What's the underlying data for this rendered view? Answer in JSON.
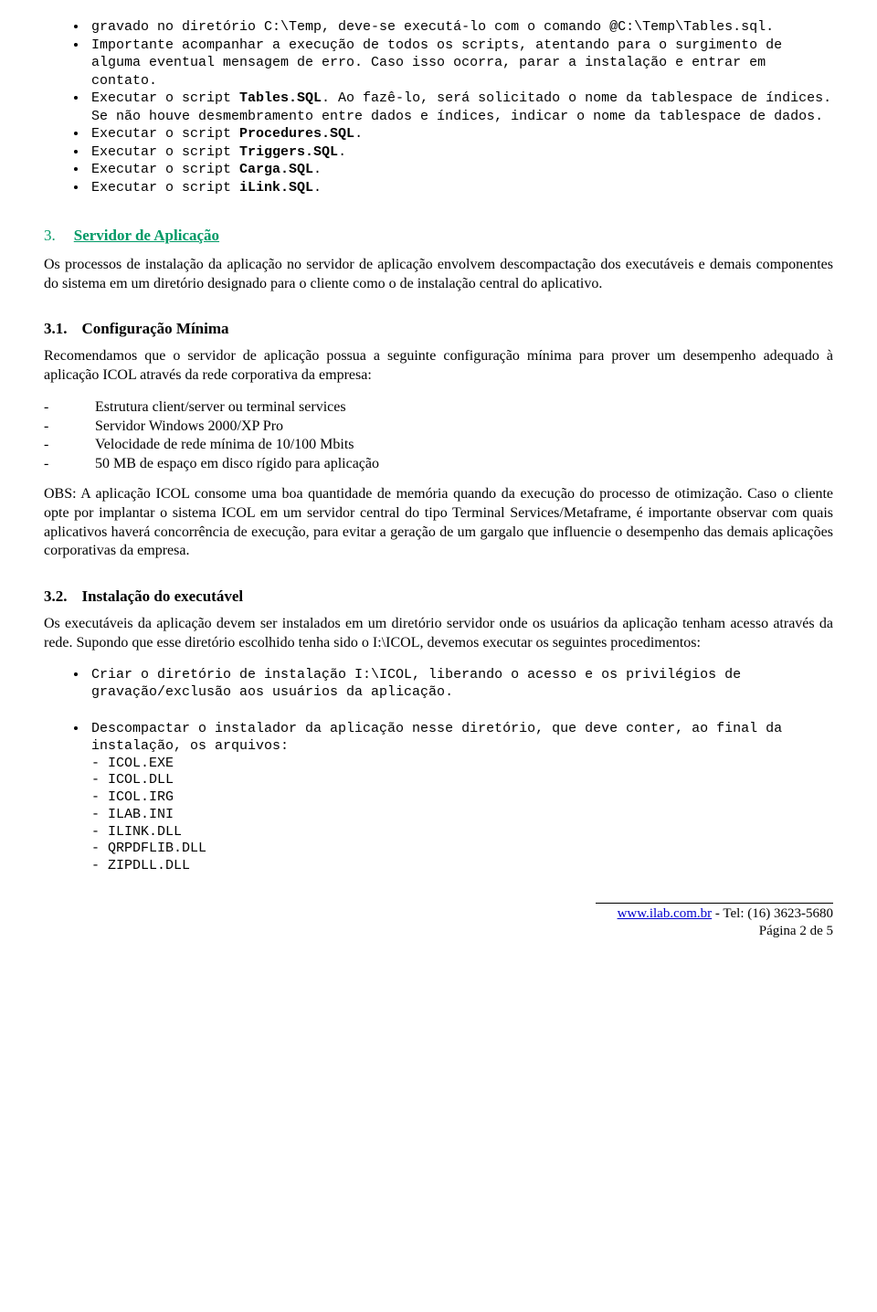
{
  "topBullets": {
    "b1a": "gravado no diretório C:\\Temp, deve-se executá-lo com o comando @C:\\Temp\\Tables.sql.",
    "b2a": "Importante acompanhar a execução de todos os scripts, atentando para o surgimento de alguma eventual mensagem de erro. Caso isso ocorra, parar a instalação e entrar em contato.",
    "b3a": "Executar o script ",
    "b3bold": "Tables.SQL",
    "b3b": ". Ao fazê-lo, será solicitado o nome da tablespace de índices. Se não houve desmembramento entre dados e índices, indicar o nome da tablespace de dados.",
    "b4a": "Executar o script ",
    "b4bold": "Procedures.SQL",
    "b4b": ".",
    "b5a": "Executar o script ",
    "b5bold": "Triggers.SQL",
    "b5b": ".",
    "b6a": "Executar o script ",
    "b6bold": "Carga.SQL",
    "b6b": ".",
    "b7a": "Executar o script ",
    "b7bold": "iLink.SQL",
    "b7b": "."
  },
  "section3": {
    "num": "3.",
    "title": "Servidor de Aplicação",
    "intro": "Os processos de instalação da aplicação no servidor de aplicação envolvem descompactação dos executáveis e demais componentes do sistema em um diretório designado para o cliente como o de instalação central do aplicativo."
  },
  "section31": {
    "num": "3.1.",
    "title": "Configuração Mínima",
    "intro": "Recomendamos que o servidor de aplicação possua a seguinte configuração mínima para prover um desempenho adequado à aplicação ICOL através da rede corporativa da empresa:",
    "items": [
      "Estrutura client/server ou terminal services",
      "Servidor Windows 2000/XP Pro",
      "Velocidade de rede mínima de 10/100 Mbits",
      "50 MB de espaço em disco rígido para aplicação"
    ],
    "obs": "OBS: A aplicação ICOL consome uma boa quantidade de memória quando da execução do processo de otimização. Caso o cliente opte por implantar o sistema ICOL em um servidor central do tipo Terminal Services/Metaframe, é importante observar com quais aplicativos haverá concorrência de execução, para evitar a geração de um gargalo que influencie o desempenho das demais aplicações corporativas da empresa."
  },
  "section32": {
    "num": "3.2.",
    "title": "Instalação do executável",
    "intro": "Os executáveis da aplicação devem ser instalados em um diretório servidor onde os usuários da aplicação tenham acesso através da rede. Supondo que esse diretório escolhido tenha sido o I:\\ICOL, devemos executar os seguintes procedimentos:",
    "b1": "Criar o diretório de instalação I:\\ICOL, liberando o acesso e os privilégios de gravação/exclusão aos usuários da aplicação.",
    "b2": "Descompactar o instalador da aplicação nesse diretório, que deve conter, ao final da instalação, os arquivos:",
    "files": [
      "- ICOL.EXE",
      "- ICOL.DLL",
      "- ICOL.IRG",
      "- ILAB.INI",
      "- ILINK.DLL",
      "- QRPDFLIB.DLL",
      "- ZIPDLL.DLL"
    ]
  },
  "footer": {
    "link": "www.ilab.com.br",
    "tel": " - Tel: (16) 3623-5680",
    "page": "Página 2 de 5"
  }
}
